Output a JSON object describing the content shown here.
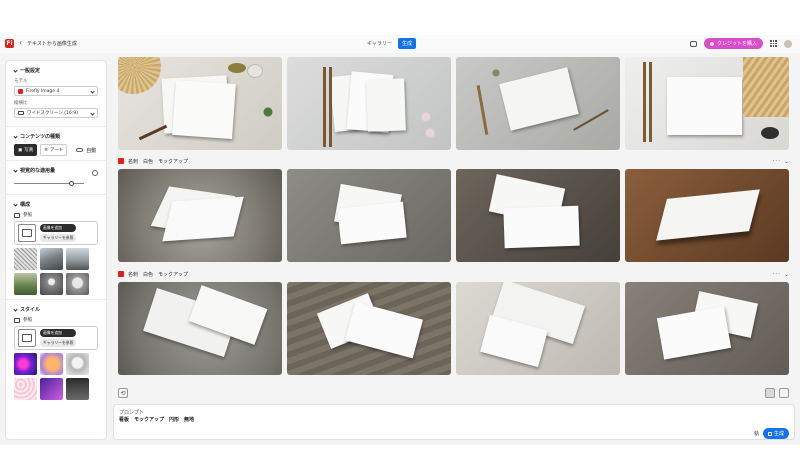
{
  "header": {
    "back_label": "‹",
    "title": "テキストから画像生成",
    "tabs": [
      {
        "label": "ギャラリー",
        "active": false
      },
      {
        "label": "生成",
        "active": true
      }
    ],
    "credits_button": "クレジットを購入"
  },
  "sidebar": {
    "general": {
      "title": "一般設定",
      "model_label": "モデル",
      "model_value": "Firefly Image 4",
      "aspect_label": "縦横比",
      "aspect_value": "ワイドスクリーン (16:9)"
    },
    "content_type": {
      "title": "コンテンツの種類",
      "photo": "写真",
      "art": "アート",
      "auto": "自動"
    },
    "visual_intensity": {
      "title": "視覚的な適用量",
      "level": 0.82
    },
    "composition": {
      "title": "構成",
      "ref_label": "参照",
      "upload_btn": "画像を追加",
      "gallery_btn": "ギャラリーを参照"
    },
    "style": {
      "title": "スタイル",
      "ref_label": "参照",
      "upload_btn": "画像を追加",
      "gallery_btn": "ギャラリーを参照"
    }
  },
  "rows": [
    {
      "label": ""
    },
    {
      "label": "名刺　白色　モックアップ"
    },
    {
      "label": "名刺　白色　モックアップ"
    }
  ],
  "prompt": {
    "label": "プロンプト",
    "text": "看板　モックアップ　円形　無地",
    "lang": "執",
    "generate": "生成"
  },
  "colors": {
    "accent": "#1473e6",
    "brand": "#e0201b",
    "credits": "#d94dc9"
  }
}
